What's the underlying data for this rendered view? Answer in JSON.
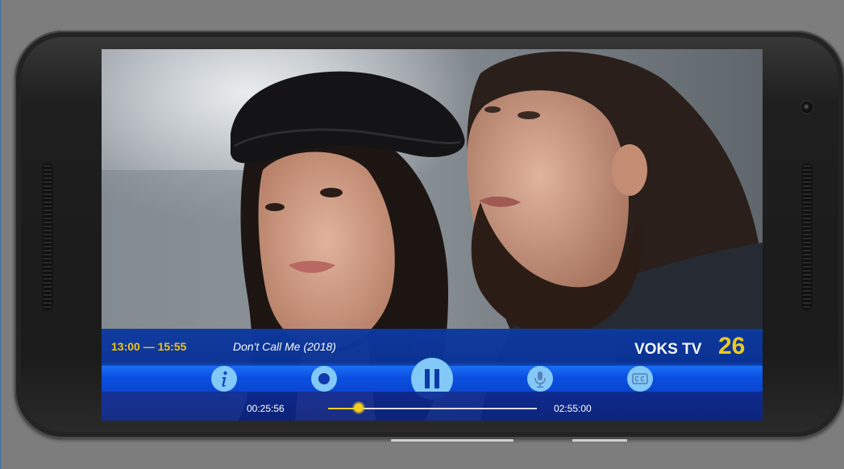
{
  "player": {
    "time_range": "13:00 — 15:55",
    "program_title": "Don't Call Me (2018)",
    "channel_name": "VOKS TV",
    "channel_number": "26",
    "elapsed": "00:25:56",
    "total": "02:55:00",
    "progress": 0.148
  },
  "controls": [
    {
      "name": "info-button",
      "icon": "info-icon"
    },
    {
      "name": "record-button",
      "icon": "record-icon"
    },
    {
      "name": "pause-button",
      "icon": "pause-icon"
    },
    {
      "name": "audio-button",
      "icon": "microphone-icon"
    },
    {
      "name": "subtitles-button",
      "icon": "cc-icon"
    }
  ],
  "colors": {
    "accent_yellow": "#f2c31a",
    "bar_blue": "#0d3aa0",
    "button_light_blue": "#82c9f8",
    "icon_blue": "#1246c4"
  }
}
